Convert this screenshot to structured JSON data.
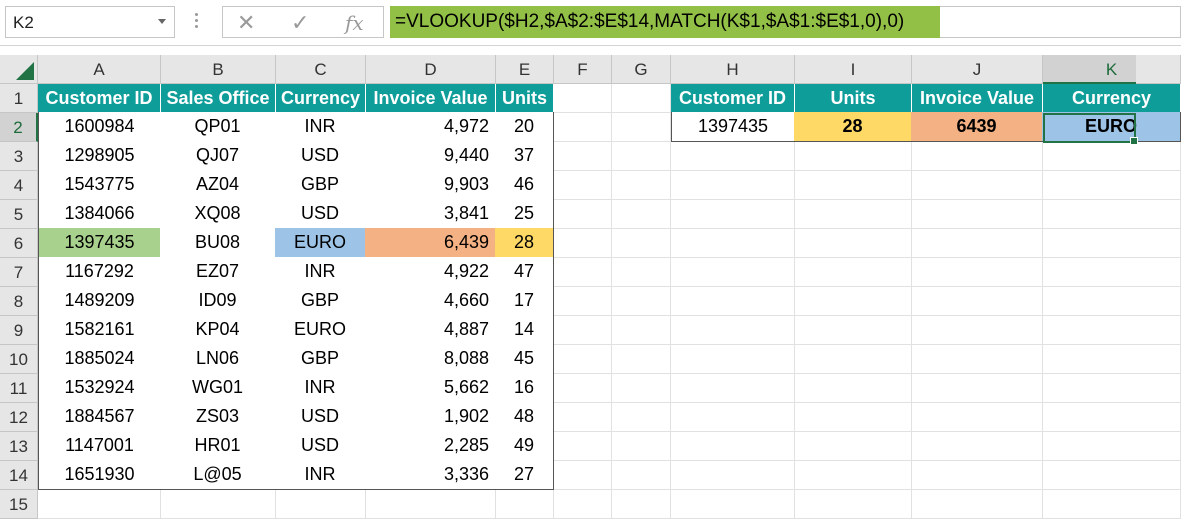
{
  "name_box": {
    "value": "K2"
  },
  "formula_bar": {
    "formula": "=VLOOKUP($H2,$A$2:$E$14,MATCH(K$1,$A$1:$E$1,0),0)"
  },
  "columns": [
    "A",
    "B",
    "C",
    "D",
    "E",
    "F",
    "G",
    "H",
    "I",
    "J",
    "K"
  ],
  "rows": [
    "1",
    "2",
    "3",
    "4",
    "5",
    "6",
    "7",
    "8",
    "9",
    "10",
    "11",
    "12",
    "13",
    "14",
    "15"
  ],
  "table": {
    "headers": [
      "Customer ID",
      "Sales Office",
      "Currency",
      "Invoice Value",
      "Units"
    ],
    "rows": [
      [
        "1600984",
        "QP01",
        "INR",
        "4,972",
        "20"
      ],
      [
        "1298905",
        "QJ07",
        "USD",
        "9,440",
        "37"
      ],
      [
        "1543775",
        "AZ04",
        "GBP",
        "9,903",
        "46"
      ],
      [
        "1384066",
        "XQ08",
        "USD",
        "3,841",
        "25"
      ],
      [
        "1397435",
        "BU08",
        "EURO",
        "6,439",
        "28"
      ],
      [
        "1167292",
        "EZ07",
        "INR",
        "4,922",
        "47"
      ],
      [
        "1489209",
        "ID09",
        "GBP",
        "4,660",
        "17"
      ],
      [
        "1582161",
        "KP04",
        "EURO",
        "4,887",
        "14"
      ],
      [
        "1885024",
        "LN06",
        "GBP",
        "8,088",
        "45"
      ],
      [
        "1532924",
        "WG01",
        "INR",
        "5,662",
        "16"
      ],
      [
        "1884567",
        "ZS03",
        "USD",
        "1,902",
        "48"
      ],
      [
        "1147001",
        "HR01",
        "USD",
        "2,285",
        "49"
      ],
      [
        "1651930",
        "L@05",
        "INR",
        "3,336",
        "27"
      ]
    ]
  },
  "lookup": {
    "headers": [
      "Customer ID",
      "Units",
      "Invoice Value",
      "Currency"
    ],
    "values": [
      "1397435",
      "28",
      "6439",
      "EURO"
    ]
  },
  "colors": {
    "header_teal": "#0f9d9a",
    "match_green": "#a9d18e",
    "currency_blue": "#9dc3e6",
    "invoice_orange": "#f4b183",
    "units_yellow": "#ffd966",
    "formula_green": "#92c047",
    "selection_green": "#217346"
  },
  "selected_cell": "K2"
}
